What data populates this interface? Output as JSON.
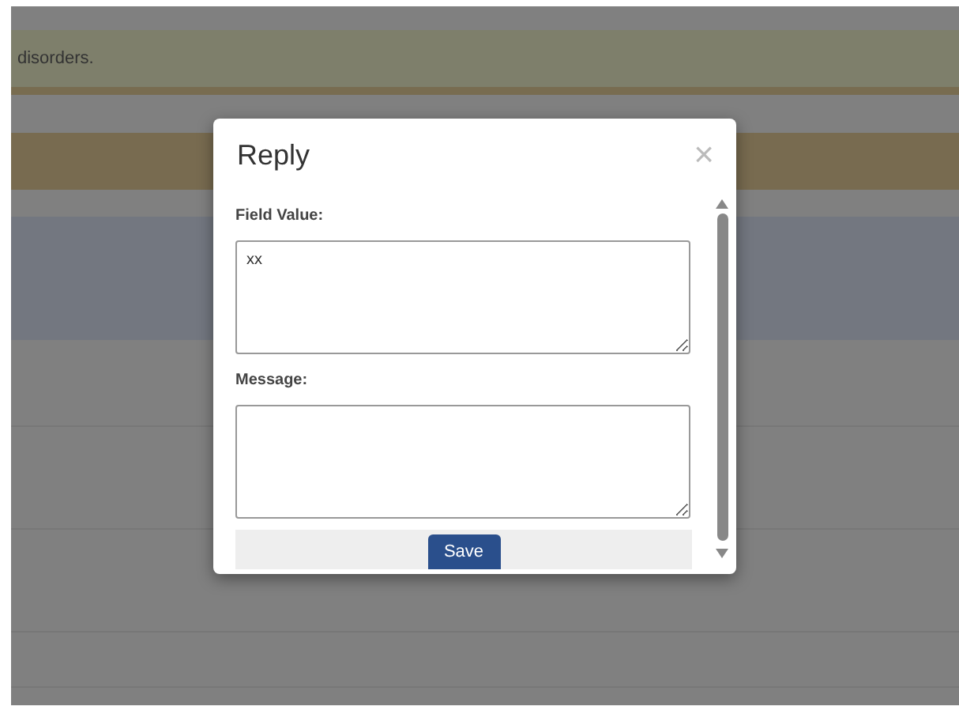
{
  "background": {
    "notice": "disorders."
  },
  "dialog": {
    "title": "Reply",
    "close": "×",
    "fields": [
      {
        "label": "Field Value:",
        "value": "xx"
      },
      {
        "label": "Message:"
      }
    ],
    "save_button": "Save"
  }
}
